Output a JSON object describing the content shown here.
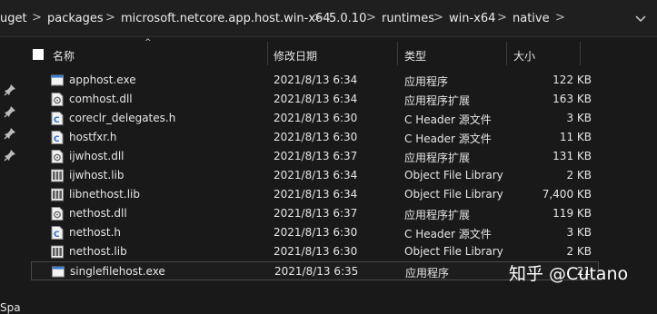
{
  "breadcrumb": [
    "uget",
    "packages",
    "microsoft.netcore.app.host.win-x64",
    "5.0.10",
    "runtimes",
    "win-x64",
    "native"
  ],
  "breadcrumb_separator": ">",
  "columns": {
    "name": "名称",
    "date": "修改日期",
    "type": "类型",
    "size": "大小"
  },
  "files": [
    {
      "name": "apphost.exe",
      "date": "2021/8/13 6:34",
      "type": "应用程序",
      "size": "122 KB",
      "icon": "exe-icon"
    },
    {
      "name": "comhost.dll",
      "date": "2021/8/13 6:34",
      "type": "应用程序扩展",
      "size": "163 KB",
      "icon": "dll-icon"
    },
    {
      "name": "coreclr_delegates.h",
      "date": "2021/8/13 6:30",
      "type": "C Header 源文件",
      "size": "3 KB",
      "icon": "c-header-icon"
    },
    {
      "name": "hostfxr.h",
      "date": "2021/8/13 6:30",
      "type": "C Header 源文件",
      "size": "11 KB",
      "icon": "c-header-icon"
    },
    {
      "name": "ijwhost.dll",
      "date": "2021/8/13 6:37",
      "type": "应用程序扩展",
      "size": "131 KB",
      "icon": "dll-icon"
    },
    {
      "name": "ijwhost.lib",
      "date": "2021/8/13 6:34",
      "type": "Object File Library",
      "size": "2 KB",
      "icon": "lib-icon"
    },
    {
      "name": "libnethost.lib",
      "date": "2021/8/13 6:34",
      "type": "Object File Library",
      "size": "7,400 KB",
      "icon": "lib-icon"
    },
    {
      "name": "nethost.dll",
      "date": "2021/8/13 6:37",
      "type": "应用程序扩展",
      "size": "119 KB",
      "icon": "dll-icon"
    },
    {
      "name": "nethost.h",
      "date": "2021/8/13 6:30",
      "type": "C Header 源文件",
      "size": "3 KB",
      "icon": "c-header-icon"
    },
    {
      "name": "nethost.lib",
      "date": "2021/8/13 6:30",
      "type": "Object File Library",
      "size": "2 KB",
      "icon": "lib-icon"
    },
    {
      "name": "singlefilehost.exe",
      "date": "2021/8/13 6:35",
      "type": "应用程序",
      "size": "21",
      "icon": "exe-icon",
      "selected": true
    }
  ],
  "left_pane": {
    "label": "Spa",
    "pins": 4
  },
  "watermark": "知乎 @Cutano",
  "colors": {
    "background": "#191919",
    "text": "#e6e6e6",
    "selected_border": "#4a4a4a",
    "icon_blue": "#3a7bd5"
  }
}
